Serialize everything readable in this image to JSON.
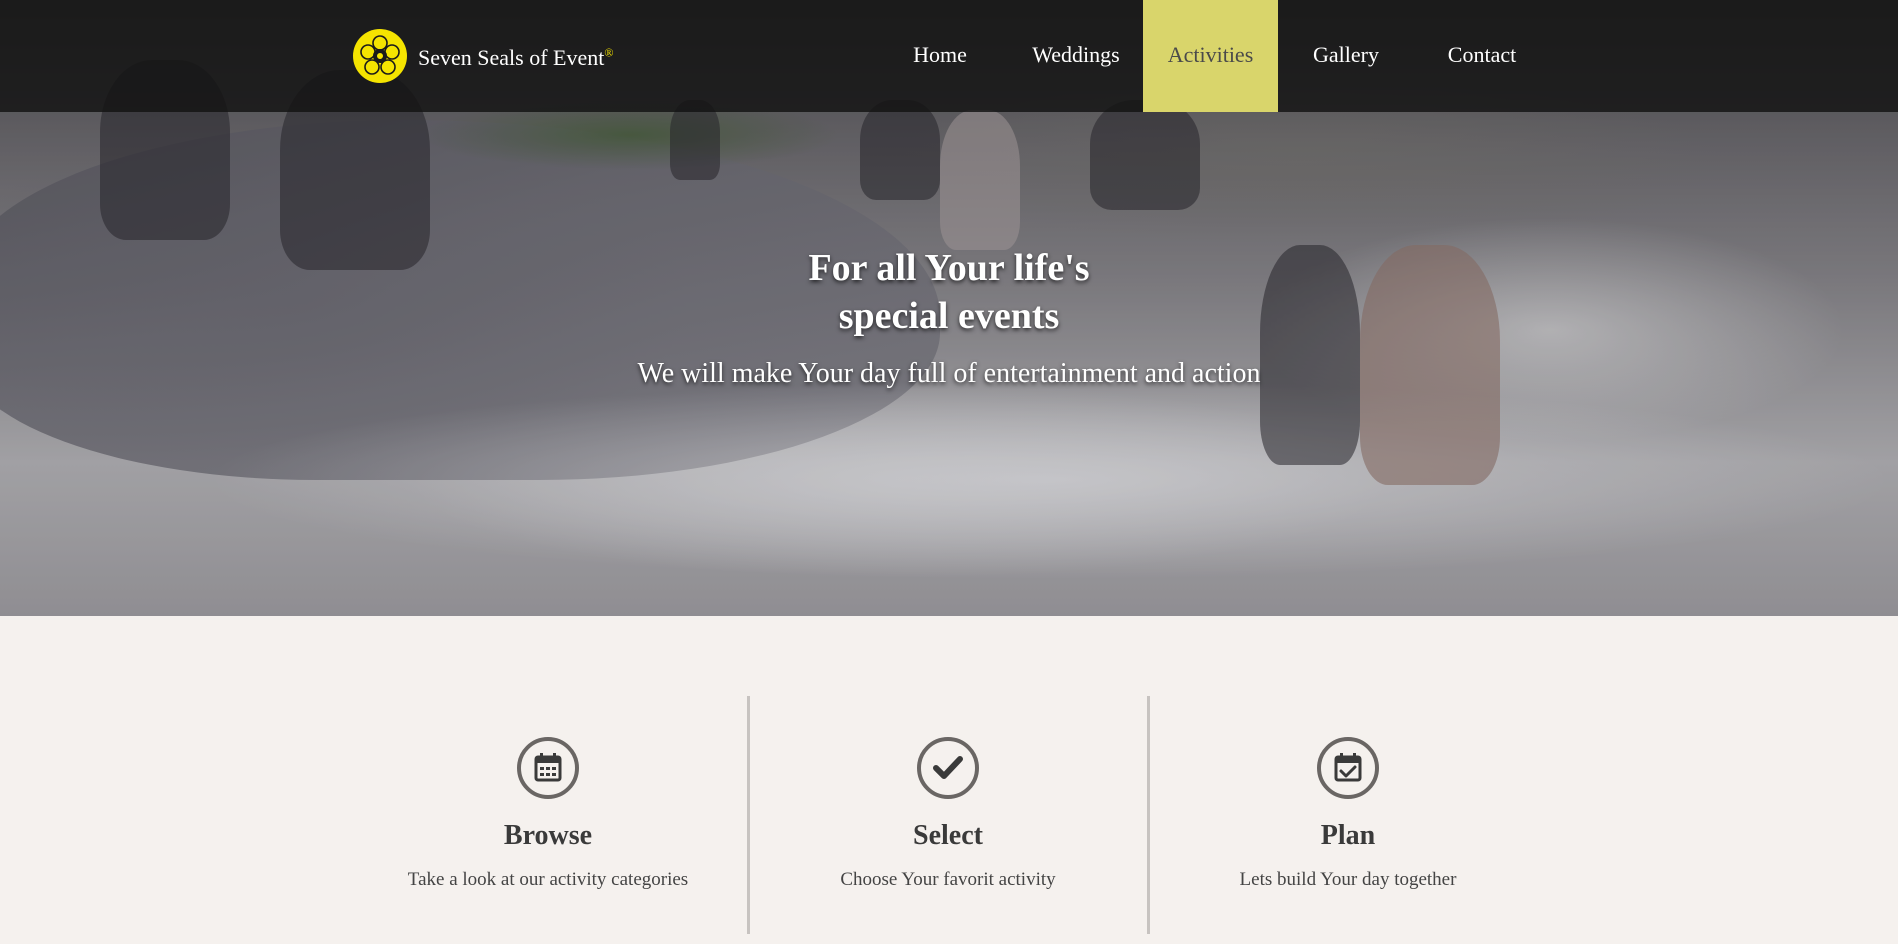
{
  "brand": {
    "name": "Seven Seals of Event",
    "registered_mark": "®",
    "accent_color": "#f5e400"
  },
  "nav": {
    "items": [
      {
        "label": "Home",
        "active": false
      },
      {
        "label": "Weddings",
        "active": false
      },
      {
        "label": "Activities",
        "active": true
      },
      {
        "label": "Gallery",
        "active": false
      },
      {
        "label": "Contact",
        "active": false
      }
    ],
    "active_color": "#d9d56b"
  },
  "hero": {
    "title_line1": "For all Your life's",
    "title_line2": "special events",
    "subtitle": "We will make Your day full of entertainment and action"
  },
  "features": [
    {
      "icon": "calendar-icon",
      "title": "Browse",
      "description": "Take a look at our activity categories"
    },
    {
      "icon": "check-circle-icon",
      "title": "Select",
      "description": "Choose Your favorit activity"
    },
    {
      "icon": "calendar-check-icon",
      "title": "Plan",
      "description": "Lets build Your day together"
    }
  ]
}
